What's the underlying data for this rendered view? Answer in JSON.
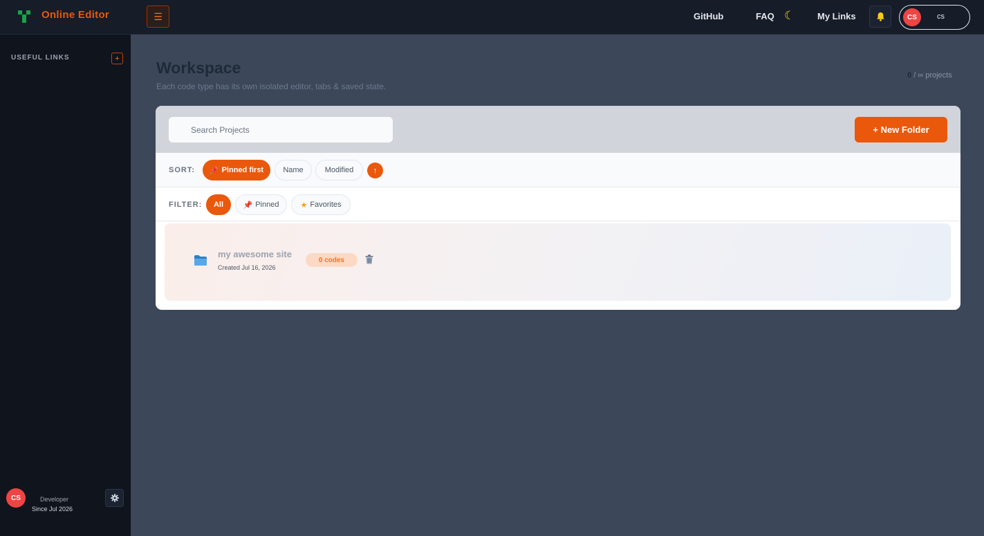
{
  "app": {
    "brand": "Online Editor"
  },
  "nav": {
    "links": [
      "GitHub",
      "FAQ",
      "My Links"
    ],
    "user": {
      "initials": "CS",
      "name": "cs"
    }
  },
  "sidebar": {
    "title": "USEFUL LINKS",
    "add_label": "+",
    "user": {
      "initials": "CS",
      "role": "Developer",
      "since": "Since Jul 2026"
    }
  },
  "workspace": {
    "title": "Workspace",
    "subtitle": "Each code type has its own isolated editor, tabs & saved state.",
    "quota_count": "0",
    "quota_rest": "/ ∞ projects",
    "search": {
      "placeholder": "Search Projects",
      "value": ""
    },
    "new_folder_label": "+ New Folder",
    "sort": {
      "label": "SORT:",
      "options": [
        "Pinned first",
        "Name",
        "Modified"
      ],
      "selected": "Pinned first",
      "direction_symbol": "↑"
    },
    "filter": {
      "label": "FILTER:",
      "options": [
        "All",
        "Pinned",
        "Favorites"
      ],
      "selected": "All"
    },
    "projects": [
      {
        "name": "my awesome site",
        "created": "Created Jul 16, 2026",
        "codes": "0 codes"
      }
    ]
  },
  "colors": {
    "accent": "#ea580c",
    "avatar": "#ef4444",
    "logo": "#16a34a"
  }
}
